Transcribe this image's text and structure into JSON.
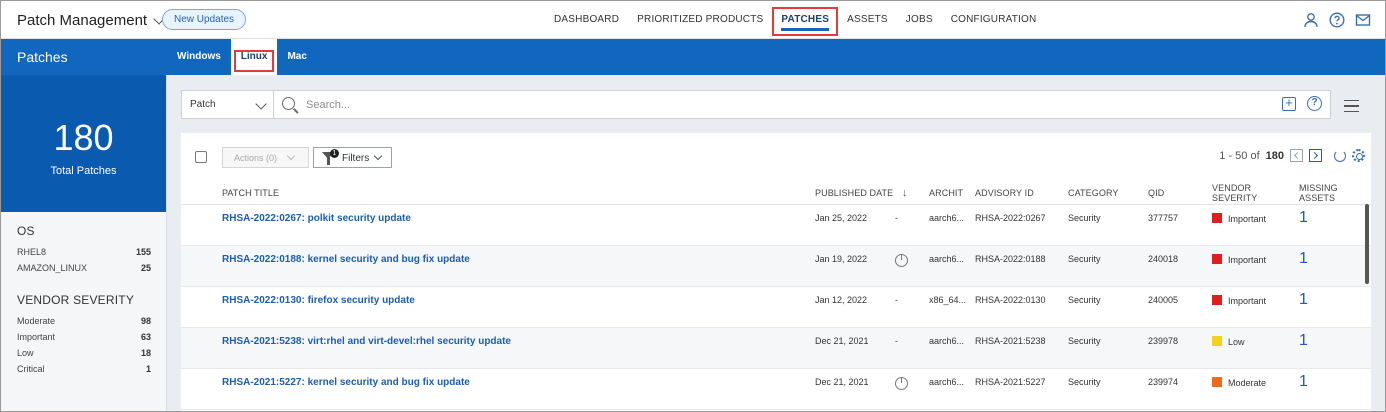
{
  "app": {
    "title": "Patch Management",
    "new_updates_label": "New Updates"
  },
  "topnav": [
    {
      "label": "DASHBOARD",
      "active": false
    },
    {
      "label": "PRIORITIZED PRODUCTS",
      "active": false
    },
    {
      "label": "PATCHES",
      "active": true
    },
    {
      "label": "ASSETS",
      "active": false
    },
    {
      "label": "JOBS",
      "active": false
    },
    {
      "label": "CONFIGURATION",
      "active": false
    }
  ],
  "top_icons": [
    "user-icon",
    "help-icon",
    "mail-icon"
  ],
  "band": {
    "title": "Patches",
    "tabs": [
      {
        "label": "Windows",
        "active": false
      },
      {
        "label": "Linux",
        "active": true
      },
      {
        "label": "Mac",
        "active": false
      }
    ]
  },
  "sidebar": {
    "total": "180",
    "total_label": "Total Patches",
    "os_heading": "OS",
    "os_items": [
      {
        "name": "RHEL8",
        "count": "155"
      },
      {
        "name": "AMAZON_LINUX",
        "count": "25"
      }
    ],
    "severity_heading": "VENDOR SEVERITY",
    "severity_items": [
      {
        "name": "Moderate",
        "count": "98"
      },
      {
        "name": "Important",
        "count": "63"
      },
      {
        "name": "Low",
        "count": "18"
      },
      {
        "name": "Critical",
        "count": "1"
      }
    ]
  },
  "search": {
    "type_value": "Patch",
    "placeholder": "Search..."
  },
  "toolbar": {
    "actions_label": "Actions (0)",
    "filters_label": "Filters",
    "filters_count": "1",
    "range": "1 - 50 of",
    "total": "180"
  },
  "colors": {
    "accent": "#1166bd",
    "important": "#e01e1e",
    "low": "#f2d21b",
    "moderate": "#ec6a1e"
  },
  "table": {
    "columns": [
      "PATCH TITLE",
      "PUBLISHED DATE",
      "ARCHIT",
      "ADVISORY ID",
      "CATEGORY",
      "QID",
      "VENDOR SEVERITY",
      "MISSING ASSETS"
    ],
    "rows": [
      {
        "title": "RHSA-2022:0267: polkit security update",
        "date": "Jan 25, 2022",
        "reboot": "-",
        "arch": "aarch6...",
        "advisory": "RHSA-2022:0267",
        "category": "Security",
        "qid": "377757",
        "severity": "Important",
        "sev_color": "#e01e1e",
        "missing": "1"
      },
      {
        "title": "RHSA-2022:0188: kernel security and bug fix update",
        "date": "Jan 19, 2022",
        "reboot": "icon",
        "arch": "aarch6...",
        "advisory": "RHSA-2022:0188",
        "category": "Security",
        "qid": "240018",
        "severity": "Important",
        "sev_color": "#e01e1e",
        "missing": "1"
      },
      {
        "title": "RHSA-2022:0130: firefox security update",
        "date": "Jan 12, 2022",
        "reboot": "-",
        "arch": "x86_64...",
        "advisory": "RHSA-2022:0130",
        "category": "Security",
        "qid": "240005",
        "severity": "Important",
        "sev_color": "#e01e1e",
        "missing": "1"
      },
      {
        "title": "RHSA-2021:5238: virt:rhel and virt-devel:rhel security update",
        "date": "Dec 21, 2021",
        "reboot": "-",
        "arch": "aarch6...",
        "advisory": "RHSA-2021:5238",
        "category": "Security",
        "qid": "239978",
        "severity": "Low",
        "sev_color": "#f2d21b",
        "missing": "1"
      },
      {
        "title": "RHSA-2021:5227: kernel security and bug fix update",
        "date": "Dec 21, 2021",
        "reboot": "icon",
        "arch": "aarch6...",
        "advisory": "RHSA-2021:5227",
        "category": "Security",
        "qid": "239974",
        "severity": "Moderate",
        "sev_color": "#ec6a1e",
        "missing": "1"
      }
    ]
  }
}
